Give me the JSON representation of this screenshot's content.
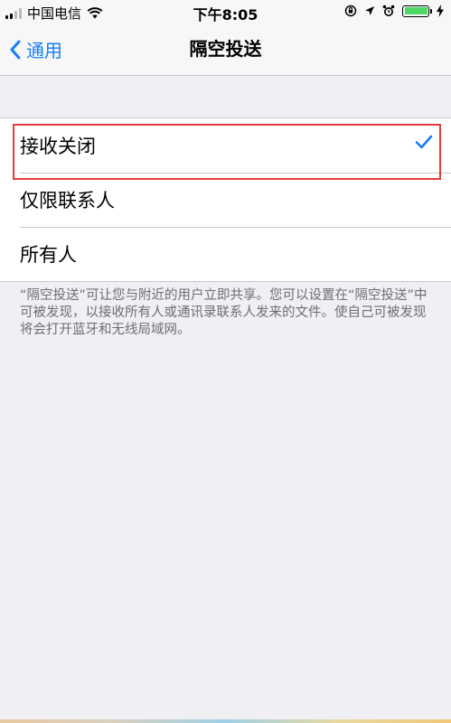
{
  "status_bar": {
    "carrier": "中国电信",
    "time": "下午8:05"
  },
  "nav": {
    "back_label": "通用",
    "title": "隔空投送"
  },
  "options": [
    {
      "label": "接收关闭",
      "selected": true
    },
    {
      "label": "仅限联系人",
      "selected": false
    },
    {
      "label": "所有人",
      "selected": false
    }
  ],
  "footer": {
    "text": "“隔空投送”可让您与附近的用户立即共享。您可以设置在“隔空投送”中可被发现，以接收所有人或通讯录联系人发来的文件。使自己可被发现将会打开蓝牙和无线局域网。"
  },
  "colors": {
    "accent": "#157efb",
    "highlight": "#e53b3b",
    "battery": "#4cd964"
  }
}
